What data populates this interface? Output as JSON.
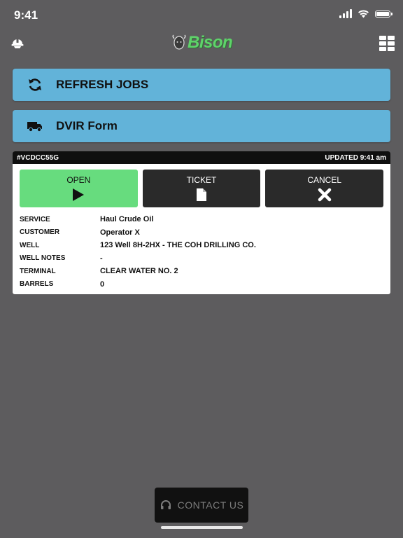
{
  "status_bar": {
    "time": "9:41"
  },
  "header": {
    "logo_text": "Bison"
  },
  "actions": {
    "refresh_label": "REFRESH JOBS",
    "dvir_label": "DVIR Form"
  },
  "job": {
    "id": "#VCDCC55G",
    "updated": "UPDATED 9:41 am",
    "buttons": {
      "open": "OPEN",
      "ticket": "TICKET",
      "cancel": "CANCEL"
    },
    "details": [
      {
        "key": "SERVICE",
        "value": "Haul Crude Oil"
      },
      {
        "key": "CUSTOMER",
        "value": "Operator X"
      },
      {
        "key": "WELL",
        "value": "123 Well 8H-2HX - THE COH DRILLING CO."
      },
      {
        "key": "WELL NOTES",
        "value": "-"
      },
      {
        "key": "TERMINAL",
        "value": "CLEAR WATER NO. 2"
      },
      {
        "key": "BARRELS",
        "value": "0"
      }
    ]
  },
  "footer": {
    "contact_label": "CONTACT US"
  },
  "colors": {
    "background": "#5d5c5e",
    "action_blue": "#62b3d9",
    "open_green": "#67dc7e",
    "dark_button": "#2a2a2a",
    "logo_green": "#5fd36a"
  },
  "icons": {
    "helmet": "helmet-icon",
    "grid": "grid-menu-icon",
    "refresh": "refresh-icon",
    "truck": "truck-icon",
    "play": "play-icon",
    "document": "document-icon",
    "cancel": "x-icon",
    "headset": "headset-icon"
  }
}
